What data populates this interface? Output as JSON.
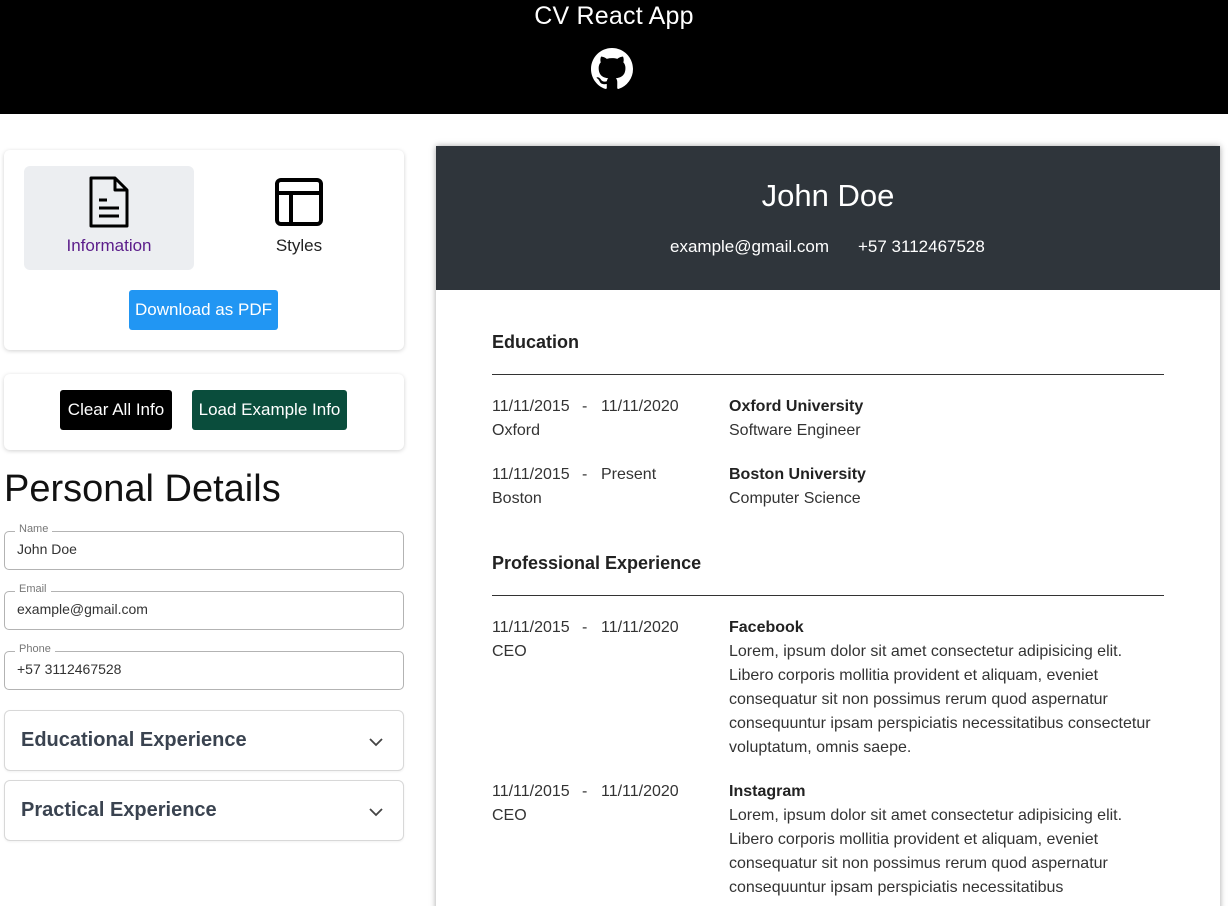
{
  "header": {
    "title": "CV React App",
    "github_icon": "github-icon"
  },
  "tabs": [
    {
      "label": "Information",
      "icon": "document-icon"
    },
    {
      "label": "Styles",
      "icon": "layout-icon"
    }
  ],
  "buttons": {
    "download": "Download as PDF",
    "clear": "Clear All Info",
    "load": "Load Example Info"
  },
  "personal": {
    "title": "Personal Details",
    "fields": [
      {
        "legend": "Name",
        "value": "John Doe"
      },
      {
        "legend": "Email",
        "value": "example@gmail.com"
      },
      {
        "legend": "Phone",
        "value": "+57 3112467528"
      }
    ]
  },
  "accordions": [
    {
      "label": "Educational Experience"
    },
    {
      "label": "Practical Experience"
    }
  ],
  "cv": {
    "name": "John Doe",
    "email": "example@gmail.com",
    "phone": "+57 3112467528",
    "education": {
      "title": "Education",
      "entries": [
        {
          "start": "11/11/2015",
          "end": "11/11/2020",
          "place": "Oxford",
          "org": "Oxford University",
          "detail": "Software Engineer"
        },
        {
          "start": "11/11/2015",
          "end": "Present",
          "place": "Boston",
          "org": "Boston University",
          "detail": "Computer Science"
        }
      ]
    },
    "experience": {
      "title": "Professional Experience",
      "entries": [
        {
          "start": "11/11/2015",
          "end": "11/11/2020",
          "place": "CEO",
          "org": "Facebook",
          "detail": "Lorem, ipsum dolor sit amet consectetur adipisicing elit. Libero corporis mollitia provident et aliquam, eveniet consequatur sit non possimus rerum quod aspernatur consequuntur ipsam perspiciatis necessitatibus consectetur voluptatum, omnis saepe."
        },
        {
          "start": "11/11/2015",
          "end": "11/11/2020",
          "place": "CEO",
          "org": "Instagram",
          "detail": "Lorem, ipsum dolor sit amet consectetur adipisicing elit. Libero corporis mollitia provident et aliquam, eveniet consequatur sit non possimus rerum quod aspernatur consequuntur ipsam perspiciatis necessitatibus"
        }
      ]
    }
  }
}
